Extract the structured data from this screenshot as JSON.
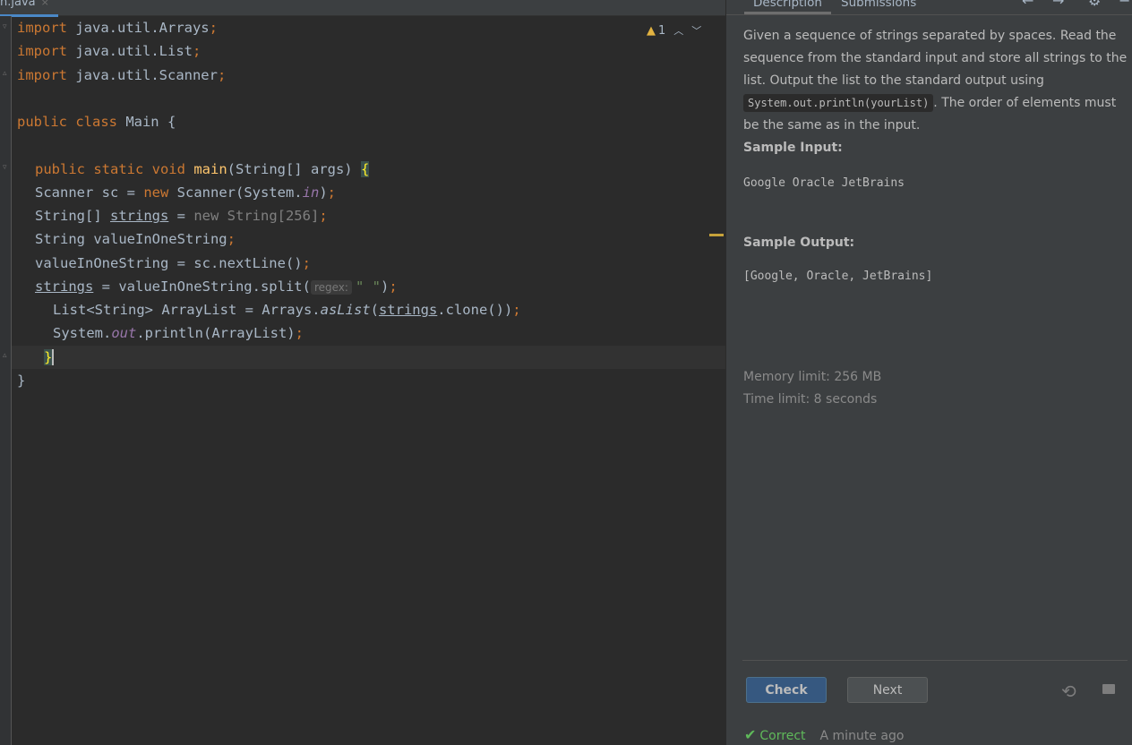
{
  "editor": {
    "tab": {
      "label": "n.java",
      "close": "×"
    },
    "warnings": {
      "count": "1"
    },
    "lines": {
      "l1": {
        "kw": "import",
        "rest": " java.util.Arrays",
        "semi": ";"
      },
      "l2": {
        "kw": "import",
        "rest": " java.util.List",
        "semi": ";"
      },
      "l3": {
        "kw": "import",
        "rest": " java.util.Scanner",
        "semi": ";"
      },
      "l5": {
        "kw": "public class",
        "name": " Main {"
      },
      "l7": {
        "kw": "public static void",
        "fn": "main",
        "args": "(String[] args) ",
        "brace": "{"
      },
      "l8": {
        "a": "Scanner sc = ",
        "kw": "new",
        "b": " Scanner(System.",
        "fld": "in",
        "c": ")",
        "semi": ";"
      },
      "l9": {
        "a": "String[] ",
        "var": "strings",
        "b": " = ",
        "gray": "new String[256]",
        "semi": ";"
      },
      "l10": {
        "a": "String valueInOneString",
        "semi": ";"
      },
      "l11": {
        "a": "valueInOneString = sc.nextLine()",
        "semi": ";"
      },
      "l12": {
        "var": "strings",
        "a": " = valueInOneString.split(",
        "hint": "regex:",
        "str": "\" \"",
        "b": ")",
        "semi": ";"
      },
      "l13": {
        "a": "List<String> ArrayList = Arrays.",
        "it": "asList",
        "b": "(",
        "var": "strings",
        "c": ".clone())",
        "semi": ";"
      },
      "l14": {
        "a": "System.",
        "fld": "out",
        "b": ".println(ArrayList)",
        "semi": ";"
      },
      "l15": {
        "brace": "}"
      },
      "l16": {
        "a": "}"
      }
    }
  },
  "panel": {
    "tabs": {
      "description": "Description",
      "submissions": "Submissions"
    },
    "description": {
      "p1": "Given a sequence of strings separated by spaces. Read the sequence from the standard input and store all strings to the list. Output the list to the standard output using ",
      "code": "System.out.println(yourList)",
      "p2": ". The order of elements must be the same as in the input.",
      "sample_input_label": "Sample Input:",
      "sample_input": "Google Oracle JetBrains",
      "sample_output_label": "Sample Output:",
      "sample_output": "[Google, Oracle, JetBrains]"
    },
    "memory_limit": "Memory limit: 256 MB",
    "time_limit": "Time limit: 8 seconds",
    "buttons": {
      "check": "Check",
      "next": "Next"
    },
    "status": {
      "label": "Correct",
      "time": "A minute ago"
    }
  }
}
